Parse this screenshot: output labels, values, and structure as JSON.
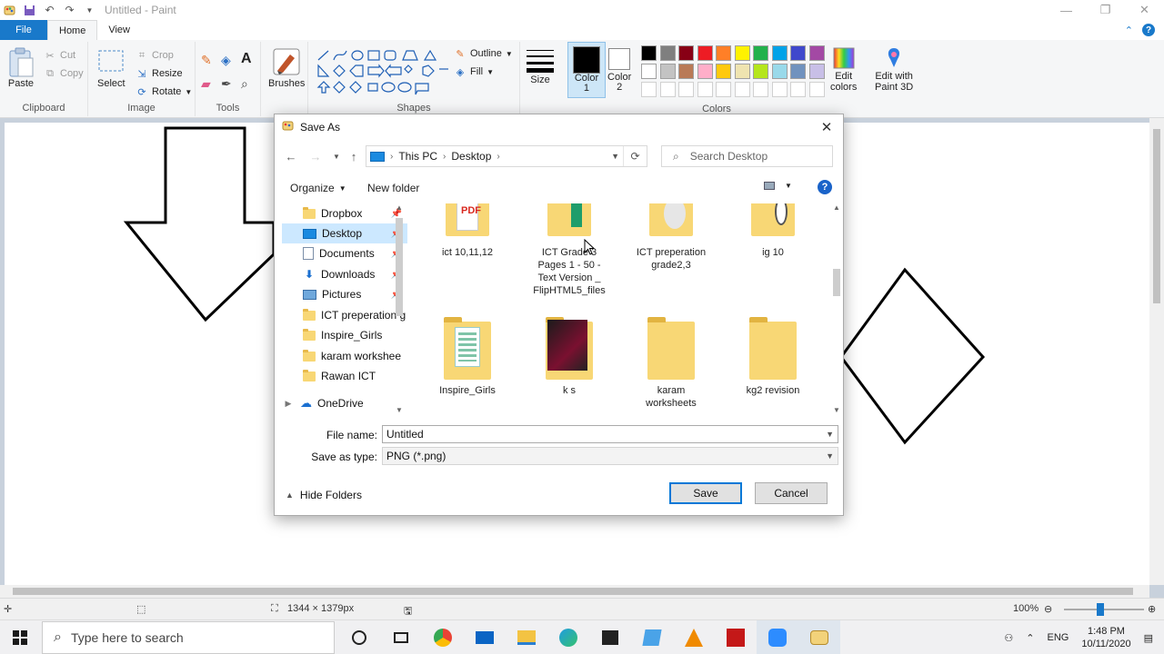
{
  "window": {
    "title": "Untitled - Paint"
  },
  "tabs": {
    "file": "File",
    "home": "Home",
    "view": "View"
  },
  "ribbon": {
    "clipboard": {
      "paste": "Paste",
      "cut": "Cut",
      "copy": "Copy",
      "label": "Clipboard"
    },
    "image": {
      "select": "Select",
      "crop": "Crop",
      "resize": "Resize",
      "rotate": "Rotate",
      "label": "Image"
    },
    "tools": {
      "label": "Tools"
    },
    "brushes": "Brushes",
    "shapes": {
      "outline": "Outline",
      "fill": "Fill",
      "label": "Shapes"
    },
    "size": "Size",
    "color1": "Color\n1",
    "color2": "Color\n2",
    "colors_label": "Colors",
    "edit_colors": "Edit\ncolors",
    "edit_3d": "Edit with\nPaint 3D",
    "palette_row1": [
      "#000000",
      "#7f7f7f",
      "#880015",
      "#ed1c24",
      "#ff7f27",
      "#fff200",
      "#22b14c",
      "#00a2e8",
      "#3f48cc",
      "#a349a4"
    ],
    "palette_row2": [
      "#ffffff",
      "#c3c3c3",
      "#b97a57",
      "#ffaec9",
      "#ffc90e",
      "#efe4b0",
      "#b5e61d",
      "#99d9ea",
      "#7092be",
      "#c8bfe7"
    ]
  },
  "dialog": {
    "title": "Save As",
    "breadcrumb": [
      "This PC",
      "Desktop"
    ],
    "search_placeholder": "Search Desktop",
    "organize": "Organize",
    "new_folder": "New folder",
    "nav_items": [
      {
        "label": "Dropbox"
      },
      {
        "label": "Desktop"
      },
      {
        "label": "Documents"
      },
      {
        "label": "Downloads"
      },
      {
        "label": "Pictures"
      },
      {
        "label": "ICT preperation g"
      },
      {
        "label": "Inspire_Girls"
      },
      {
        "label": "karam workshee"
      },
      {
        "label": "Rawan ICT"
      },
      {
        "label": "OneDrive"
      }
    ],
    "files": [
      {
        "label": "ict 10,11,12"
      },
      {
        "label": "ICT Grade 3 Pages 1 - 50 - Text Version _ FlipHTML5_files"
      },
      {
        "label": "ICT preperation grade2,3"
      },
      {
        "label": "ig 10"
      },
      {
        "label": "Inspire_Girls"
      },
      {
        "label": "k s"
      },
      {
        "label": "karam worksheets"
      },
      {
        "label": "kg2 revision"
      }
    ],
    "file_name_label": "File name:",
    "file_name_value": "Untitled",
    "save_type_label": "Save as type:",
    "save_type_value": "PNG (*.png)",
    "hide_folders": "Hide Folders",
    "save": "Save",
    "cancel": "Cancel"
  },
  "statusbar": {
    "dimensions": "1344 × 1379px",
    "zoom": "100%"
  },
  "taskbar": {
    "search_placeholder": "Type here to search",
    "lang": "ENG",
    "time": "1:48 PM",
    "date": "10/11/2020"
  }
}
